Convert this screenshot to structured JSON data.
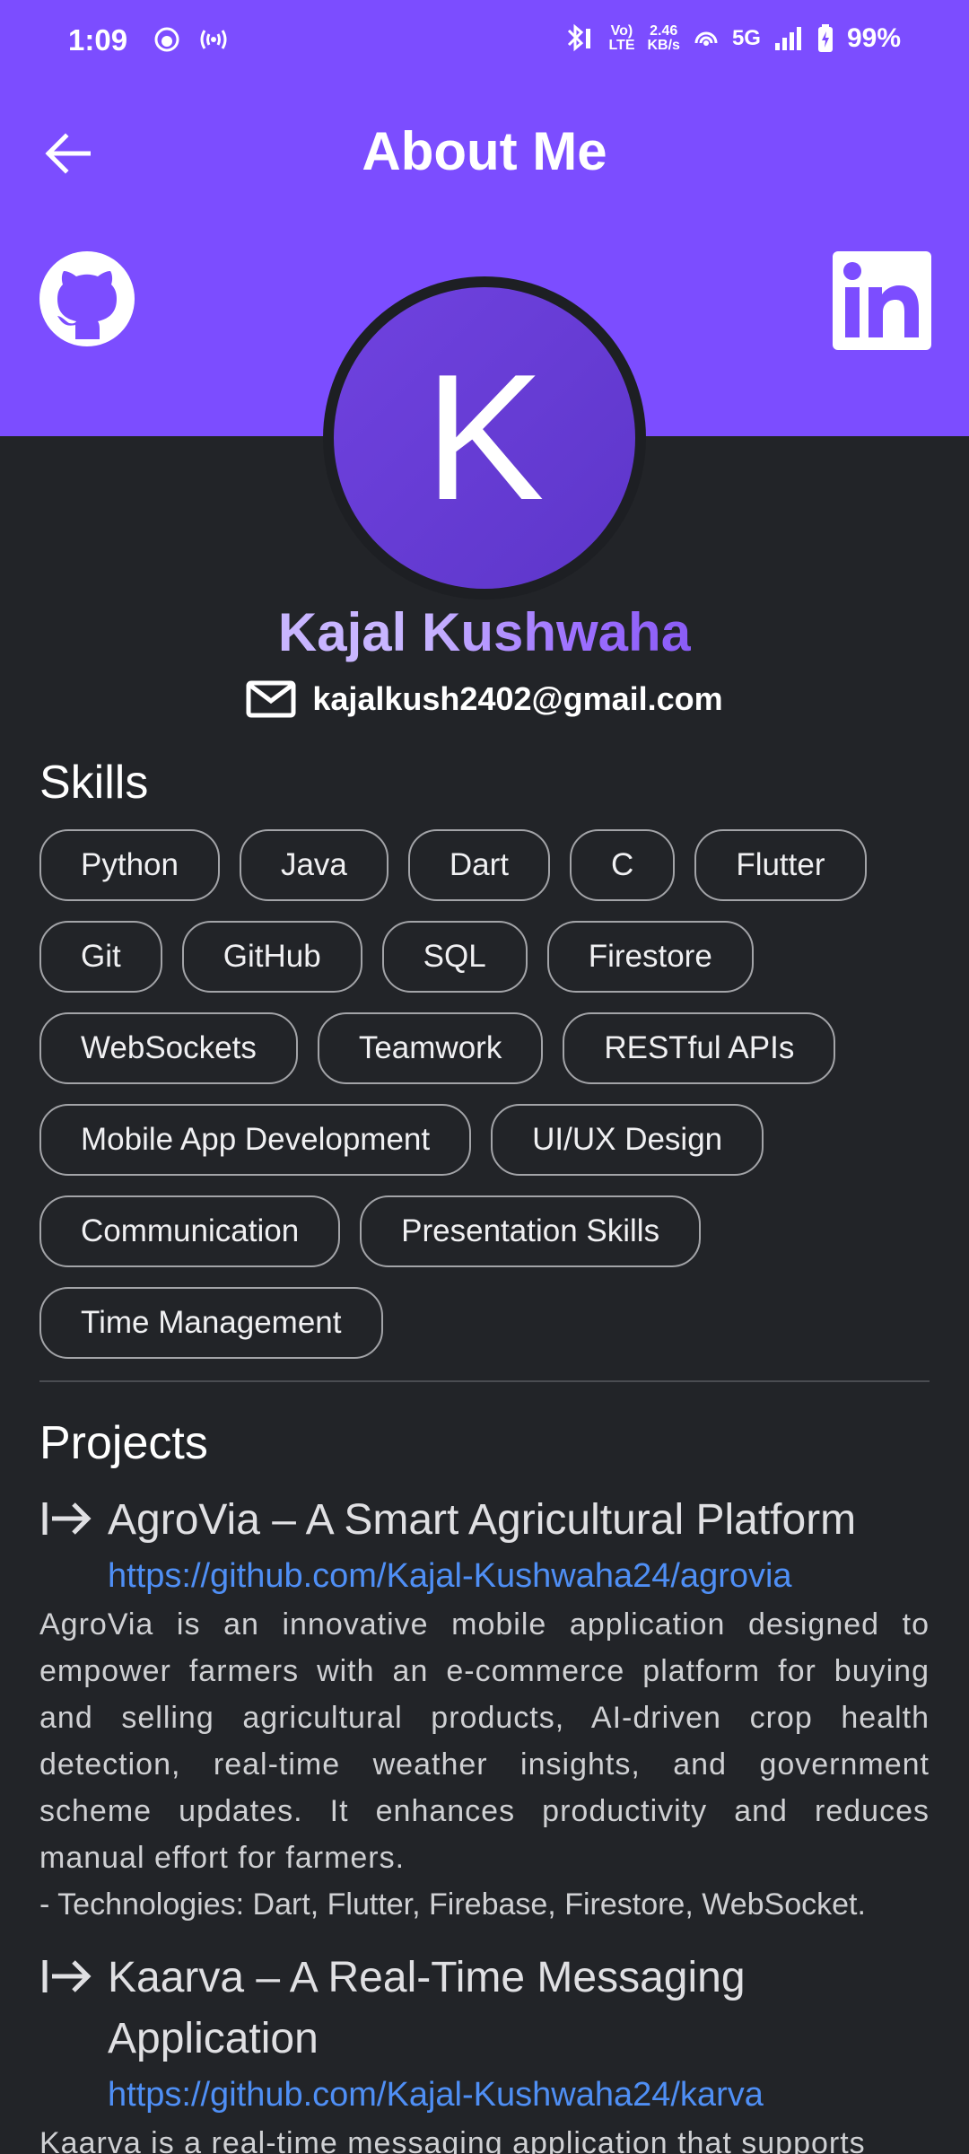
{
  "status_bar": {
    "time": "1:09",
    "lte_top": "Vo)",
    "lte_bottom": "LTE",
    "speed_top": "2.46",
    "speed_bottom": "KB/s",
    "network": "5G",
    "battery": "99%"
  },
  "appbar": {
    "title": "About Me"
  },
  "profile": {
    "avatar_letter": "K",
    "first_name": "Kajal",
    "last_name": "Kushwaha",
    "email": "kajalkush2402@gmail.com"
  },
  "skills": {
    "title": "Skills",
    "rows": [
      [
        "Python",
        "Java",
        "Dart",
        "C",
        "Flutter"
      ],
      [
        "Git",
        "GitHub",
        "SQL",
        "Firestore"
      ],
      [
        "WebSockets",
        "Teamwork",
        "RESTful APIs"
      ],
      [
        "Mobile App Development",
        "UI/UX Design"
      ],
      [
        "Communication",
        "Presentation Skills"
      ],
      [
        "Time Management"
      ]
    ]
  },
  "projects": {
    "title": "Projects",
    "items": [
      {
        "title": "AgroVia – A Smart Agricultural Platform",
        "link": "https://github.com/Kajal-Kushwaha24/agrovia",
        "description": "AgroVia is an innovative mobile application designed to empower farmers with an e-commerce platform for buying and selling agricultural products, AI-driven crop health detection, real-time weather insights, and government scheme updates. It enhances productivity and reduces manual effort for farmers.",
        "tech": "- Technologies: Dart, Flutter, Firebase, Firestore, WebSocket."
      },
      {
        "title": "Kaarva – A Real-Time Messaging Application",
        "link": "https://github.com/Kajal-Kushwaha24/karva",
        "description": "Kaarva is a real-time messaging application that supports",
        "tech": ""
      }
    ]
  },
  "colors": {
    "header": "#7c4dff",
    "background": "#222428",
    "link": "#4f8ff5",
    "chip_border": "#a3a4a8"
  }
}
